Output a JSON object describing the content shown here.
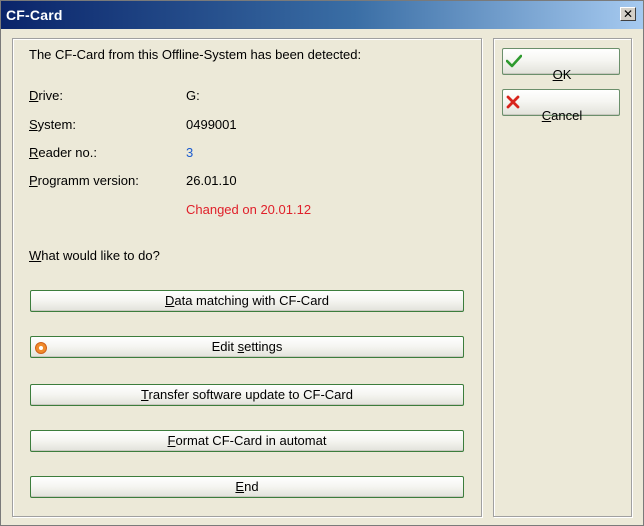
{
  "window": {
    "title": "CF-Card",
    "close_glyph": "✕"
  },
  "info": {
    "heading": "The CF-Card from this Offline-System has been detected:",
    "rows": [
      {
        "label_key": "D",
        "label_rest": "rive:",
        "value": "G:"
      },
      {
        "label_key": "S",
        "label_rest": "ystem:",
        "value": "0499001"
      },
      {
        "label_key": "R",
        "label_rest": "eader no.:",
        "value": "3"
      },
      {
        "label_key": "P",
        "label_rest": "rogramm version:",
        "value": "26.01.10"
      }
    ],
    "changed_note": "Changed on 20.01.12",
    "question_key": "W",
    "question_rest": "hat would like to do?"
  },
  "actions": [
    {
      "pre": "",
      "key": "D",
      "post": "ata matching with CF-Card"
    },
    {
      "pre": "Edit ",
      "key": "s",
      "post": "ettings"
    },
    {
      "pre": "",
      "key": "T",
      "post": "ransfer software update to CF-Card"
    },
    {
      "pre": "",
      "key": "F",
      "post": "ormat CF-Card in automat"
    },
    {
      "pre": "",
      "key": "E",
      "post": "nd"
    }
  ],
  "side_buttons": {
    "ok": {
      "key": "O",
      "rest": "K"
    },
    "cancel": {
      "key": "C",
      "rest": "ancel"
    }
  },
  "icons": {
    "ok": "checkmark-icon",
    "cancel": "red-x-icon",
    "selected_action": "radio-selected-icon"
  },
  "colors": {
    "reader_value": "#1c5ccf",
    "changed_note": "#e0202a",
    "button_border": "#3c7d3c"
  }
}
